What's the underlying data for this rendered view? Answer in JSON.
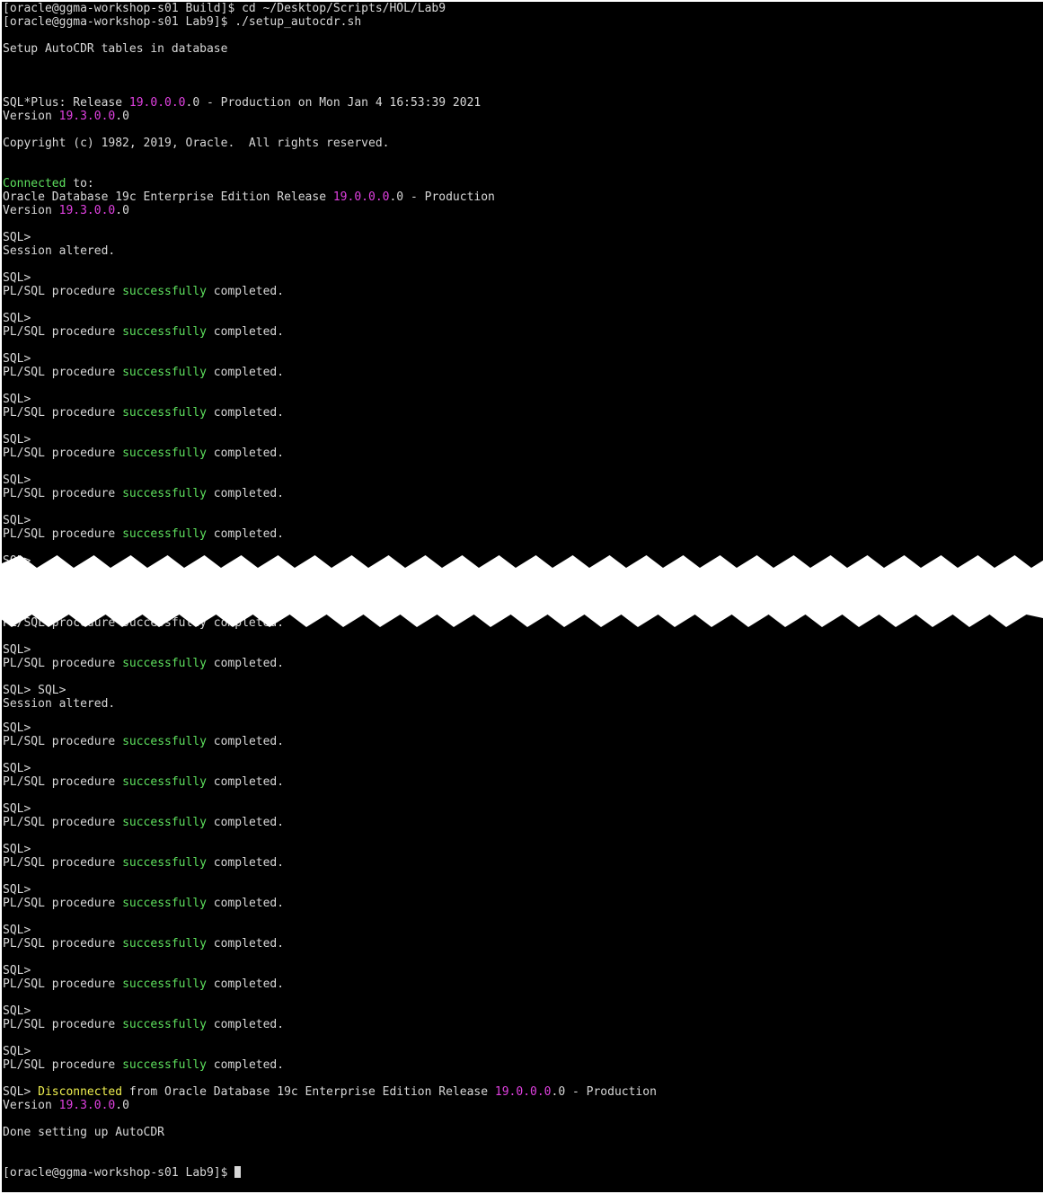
{
  "prompt_top": "[oracle@ggma-workshop-s01 Build]$ cd ~/Desktop/Scripts/HOL/Lab9",
  "prompt_run": "[oracle@ggma-workshop-s01 Lab9]$ ./setup_autocdr.sh",
  "setup_msg": "Setup AutoCDR tables in database",
  "sqlplus": {
    "pre": "SQL*Plus: Release ",
    "ver": "19.0.0.0",
    "post": ".0 - Production on Mon Jan 4 16:53:39 2021"
  },
  "version_line": {
    "pre": "Version ",
    "ver": "19.3.0.0",
    "post": ".0"
  },
  "copyright": "Copyright (c) 1982, 2019, Oracle.  All rights reserved.",
  "connected": {
    "word": "Connected",
    "rest": " to:"
  },
  "oracle_db": {
    "pre": "Oracle Database 19c Enterprise Edition Release ",
    "ver": "19.0.0.0",
    "post": ".0 - Production"
  },
  "sql_prompt": "SQL>",
  "sql_double_prompt": "SQL> SQL>",
  "session_altered": "Session altered.",
  "plsql": {
    "pre": "PL/SQL procedure ",
    "word": "successfully",
    "post": " completed."
  },
  "partial_top": "SQL>",
  "partial_bottom": "PL/SQL procedure successfully completed.",
  "disconnected": {
    "pre": "SQL> ",
    "word": "Disconnected",
    "mid": " from Oracle Database 19c Enterprise Edition Release ",
    "ver": "19.0.0.0",
    "post": ".0 - Production"
  },
  "done_msg": "Done setting up AutoCDR",
  "final_prompt": "[oracle@ggma-workshop-s01 Lab9]$ ",
  "colors": {
    "background": "#000000",
    "text": "#d8d8d8",
    "green": "#5ee05e",
    "magenta": "#e040e0",
    "yellow": "#f0f050"
  }
}
